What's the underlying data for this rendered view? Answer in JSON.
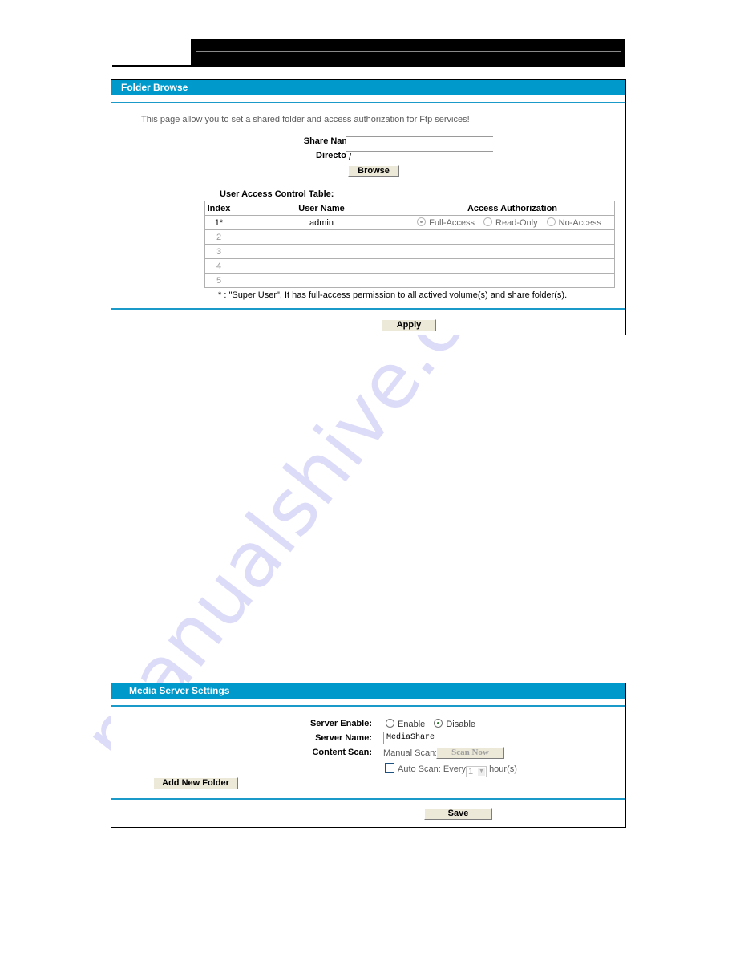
{
  "watermark": "manualshive.com",
  "folder_browse": {
    "title": "Folder Browse",
    "description": "This page allow you to set a shared folder and access authorization for Ftp services!",
    "share_name_label": "Share Name:",
    "share_name_value": "",
    "directory_label": "Directory:",
    "directory_value": "/",
    "browse_label": "Browse",
    "table_title": "User Access Control Table:",
    "table": {
      "headers": [
        "Index",
        "User Name",
        "Access Authorization"
      ],
      "rows": [
        {
          "index": "1*",
          "user_name": "admin",
          "access": "Full-Access"
        },
        {
          "index": "2",
          "user_name": "",
          "access": ""
        },
        {
          "index": "3",
          "user_name": "",
          "access": ""
        },
        {
          "index": "4",
          "user_name": "",
          "access": ""
        },
        {
          "index": "5",
          "user_name": "",
          "access": ""
        }
      ],
      "access_options": [
        "Full-Access",
        "Read-Only",
        "No-Access"
      ]
    },
    "footnote": "* : \"Super User\", It has full-access permission to all actived volume(s) and share folder(s).",
    "apply_label": "Apply"
  },
  "media_server": {
    "title": "Media Server Settings",
    "server_enable_label": "Server Enable:",
    "enable_option": "Enable",
    "disable_option": "Disable",
    "server_enable_selected": "Disable",
    "server_name_label": "Server Name:",
    "server_name_value": "MediaShare",
    "content_scan_label": "Content Scan:",
    "manual_scan_label": "Manual Scan:",
    "scan_now_label": "Scan Now",
    "auto_scan_label": "Auto Scan: Every",
    "auto_scan_checked": false,
    "auto_scan_interval": "1",
    "hours_label": "hour(s)",
    "add_folder_label": "Add New Folder",
    "save_label": "Save"
  }
}
